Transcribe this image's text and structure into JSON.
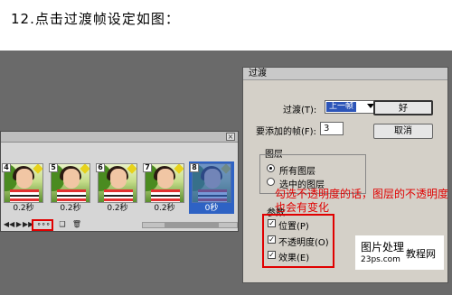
{
  "step_title": "12.点击过渡帧设定如图：",
  "animation_panel": {
    "frames": [
      {
        "number": "4",
        "delay": "0.2秒",
        "selected": false,
        "faded": false
      },
      {
        "number": "5",
        "delay": "0.2秒",
        "selected": false,
        "faded": false
      },
      {
        "number": "6",
        "delay": "0.2秒",
        "selected": false,
        "faded": false
      },
      {
        "number": "7",
        "delay": "0.2秒",
        "selected": false,
        "faded": false
      },
      {
        "number": "8",
        "delay": "0秒",
        "selected": true,
        "faded": true
      }
    ],
    "toolbar": {
      "first_frame": "◀◀",
      "prev_frame": "◀",
      "play": "▶",
      "next_frame": "▶▶",
      "tween": "∘∘∘",
      "duplicate": "❑",
      "delete": "🗑"
    },
    "close": "×"
  },
  "dialog": {
    "title": "过渡",
    "tween_with_label": "过渡(T):",
    "tween_with_value": "上一帧",
    "frames_to_add_label": "要添加的帧(F):",
    "frames_to_add_value": "3",
    "ok_label": "好",
    "cancel_label": "取消",
    "layers_group_label": "图层",
    "all_layers_label": "所有图层",
    "selected_layers_label": "选中的图层",
    "params_label": "参数",
    "position_label": "位置(P)",
    "opacity_label": "不透明度(O)",
    "effects_label": "效果(E)"
  },
  "annotation": "勾选不透明度的话，图层的不透明度也会有变化",
  "watermark": {
    "title": "图片处理",
    "accent": "教程网",
    "url": "23ps.com"
  },
  "colors": {
    "highlight": "#e00000",
    "selection": "#2e62c4",
    "backdrop": "#6a6a6a"
  }
}
